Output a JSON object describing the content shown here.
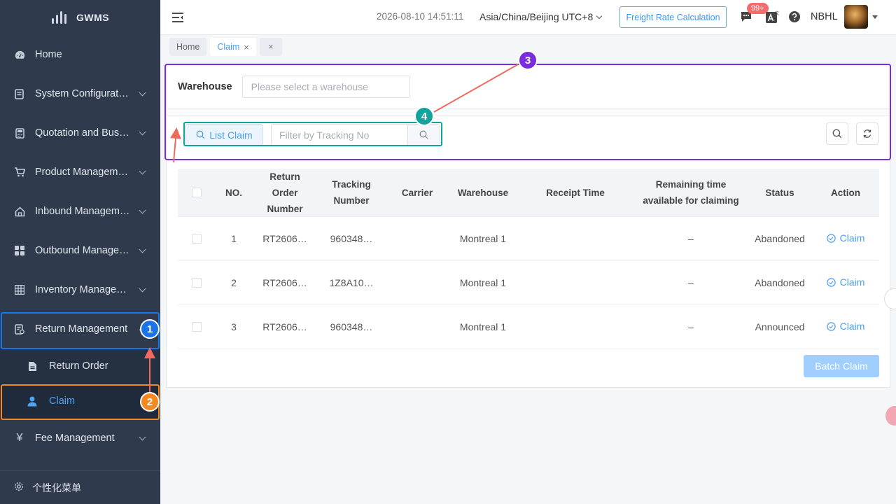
{
  "app": {
    "name": "GWMS"
  },
  "sidebar": {
    "items": [
      {
        "label": "Home",
        "icon": "dashboard-icon"
      },
      {
        "label": "System Configuration",
        "icon": "config-icon"
      },
      {
        "label": "Quotation and Business",
        "icon": "calculator-icon"
      },
      {
        "label": "Product Management",
        "icon": "cart-icon"
      },
      {
        "label": "Inbound Management",
        "icon": "home-inbound-icon"
      },
      {
        "label": "Outbound Management",
        "icon": "grid-icon"
      },
      {
        "label": "Inventory Management",
        "icon": "inventory-icon"
      },
      {
        "label": "Return Management",
        "icon": "return-icon"
      },
      {
        "label": "Fee Management",
        "icon": "yen-icon"
      }
    ],
    "sub_items": [
      {
        "label": "Return Order",
        "icon": "document-icon"
      },
      {
        "label": "Claim",
        "icon": "user-icon"
      }
    ],
    "personal_menu": "个性化菜单"
  },
  "header": {
    "datetime": "2026-08-10 14:51:11",
    "timezone": "Asia/China/Beijing UTC+8",
    "freight_button": "Freight Rate Calculation",
    "badge": "99+",
    "user": "NBHL"
  },
  "tabs": [
    {
      "label": "Home"
    },
    {
      "label": "Claim"
    }
  ],
  "filters": {
    "warehouse_label": "Warehouse",
    "warehouse_placeholder": "Please select a warehouse",
    "list_claim": "List Claim",
    "tracking_placeholder": "Filter by Tracking No"
  },
  "table": {
    "headers": [
      "NO.",
      "Return Order Number",
      "Tracking Number",
      "Carrier",
      "Warehouse",
      "Receipt Time",
      "Remaining time available for claiming",
      "Status",
      "Action"
    ],
    "rows": [
      {
        "no": "1",
        "return_order": "RT2606…",
        "tracking": "960348…",
        "carrier": "",
        "warehouse": "Montreal 1",
        "receipt_time": "",
        "remaining": "–",
        "status": "Abandoned",
        "action": "Claim"
      },
      {
        "no": "2",
        "return_order": "RT2606…",
        "tracking": "1Z8A10…",
        "carrier": "",
        "warehouse": "Montreal 1",
        "receipt_time": "",
        "remaining": "–",
        "status": "Abandoned",
        "action": "Claim"
      },
      {
        "no": "3",
        "return_order": "RT2606…",
        "tracking": "960348…",
        "carrier": "",
        "warehouse": "Montreal 1",
        "receipt_time": "",
        "remaining": "–",
        "status": "Announced",
        "action": "Claim"
      }
    ],
    "batch_claim": "Batch Claim"
  },
  "annotations": {
    "m1": "1",
    "m2": "2",
    "m3": "3",
    "m4": "4"
  },
  "colors": {
    "sidebar": "#2f3a4c",
    "accent": "#4a9ef0",
    "marker_blue": "#1a73e8",
    "marker_orange": "#f5891f",
    "marker_purple": "#7b2cdc",
    "marker_teal": "#13a39d",
    "arrow": "#f06b5e"
  }
}
